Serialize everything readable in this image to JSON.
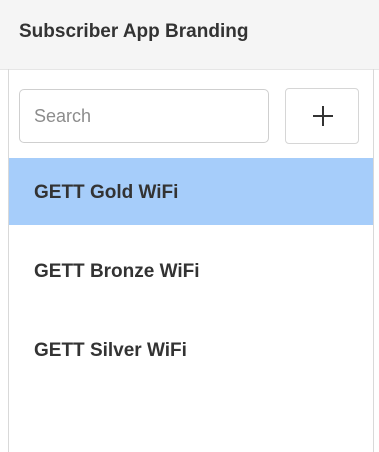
{
  "header": {
    "title": "Subscriber App Branding"
  },
  "search": {
    "placeholder": "Search",
    "value": ""
  },
  "add_button": {
    "icon": "plus-icon"
  },
  "colors": {
    "selected_row": "#a6cdfa",
    "header_bg": "#f5f5f5",
    "text": "#333333"
  },
  "list": {
    "items": [
      {
        "label": "GETT Gold WiFi",
        "selected": true
      },
      {
        "label": "GETT Bronze WiFi",
        "selected": false
      },
      {
        "label": "GETT Silver WiFi",
        "selected": false
      }
    ]
  }
}
